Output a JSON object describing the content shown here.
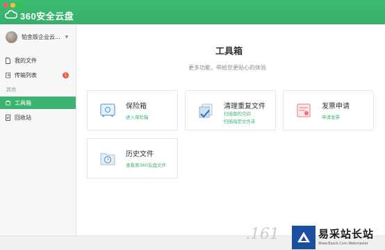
{
  "app": {
    "brand": "360安全云盘"
  },
  "account": {
    "name": "铂金版企业云..."
  },
  "sidebar": {
    "items": [
      {
        "label": "我的文件",
        "icon": "file-icon"
      },
      {
        "label": "传输列表",
        "icon": "transfer-icon",
        "badge": "1"
      },
      {
        "label": "工具箱",
        "icon": "toolbox-icon",
        "active": true
      },
      {
        "label": "回收站",
        "icon": "trash-icon"
      }
    ],
    "section_label": "其他"
  },
  "main": {
    "title": "工具箱",
    "subtitle": "更多功能，带给您更贴心的体验",
    "cards": [
      {
        "title": "保险箱",
        "lines": [
          "进入保险箱"
        ],
        "icon": "safe-icon"
      },
      {
        "title": "清理重复文件",
        "lines": [
          "扫描我的空间",
          "扫描指定文件夹"
        ],
        "icon": "clean-duplicates-icon"
      },
      {
        "title": "发票申请",
        "lines": [
          "申请发票"
        ],
        "icon": "invoice-icon"
      },
      {
        "title": "历史文件",
        "lines": [
          "查看原360云盘文件"
        ],
        "icon": "history-icon"
      }
    ]
  },
  "watermark": {
    "text": "易采站长站",
    "sub": "Www.Easck.Com Webmaster",
    "deco": ".161"
  },
  "colors": {
    "accent": "#3cb371",
    "badge": "#ef5a4a"
  }
}
